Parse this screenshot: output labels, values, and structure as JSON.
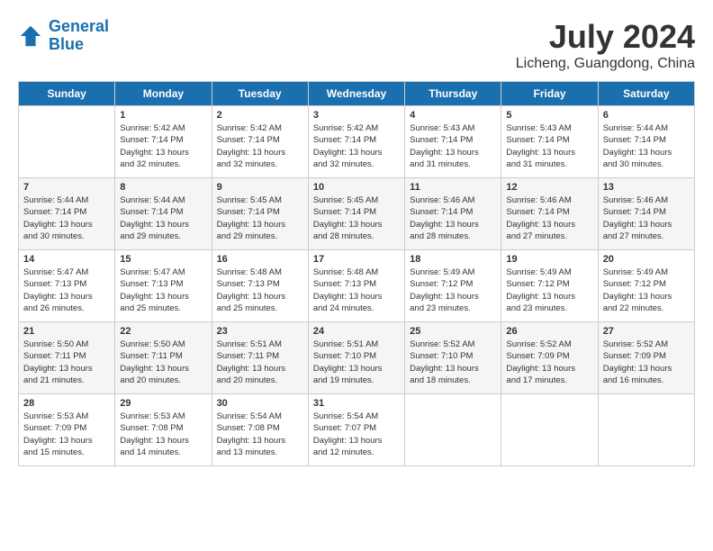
{
  "header": {
    "logo_line1": "General",
    "logo_line2": "Blue",
    "month_year": "July 2024",
    "location": "Licheng, Guangdong, China"
  },
  "weekdays": [
    "Sunday",
    "Monday",
    "Tuesday",
    "Wednesday",
    "Thursday",
    "Friday",
    "Saturday"
  ],
  "weeks": [
    [
      {
        "day": "",
        "sunrise": "",
        "sunset": "",
        "daylight": ""
      },
      {
        "day": "1",
        "sunrise": "Sunrise: 5:42 AM",
        "sunset": "Sunset: 7:14 PM",
        "daylight": "Daylight: 13 hours and 32 minutes."
      },
      {
        "day": "2",
        "sunrise": "Sunrise: 5:42 AM",
        "sunset": "Sunset: 7:14 PM",
        "daylight": "Daylight: 13 hours and 32 minutes."
      },
      {
        "day": "3",
        "sunrise": "Sunrise: 5:42 AM",
        "sunset": "Sunset: 7:14 PM",
        "daylight": "Daylight: 13 hours and 32 minutes."
      },
      {
        "day": "4",
        "sunrise": "Sunrise: 5:43 AM",
        "sunset": "Sunset: 7:14 PM",
        "daylight": "Daylight: 13 hours and 31 minutes."
      },
      {
        "day": "5",
        "sunrise": "Sunrise: 5:43 AM",
        "sunset": "Sunset: 7:14 PM",
        "daylight": "Daylight: 13 hours and 31 minutes."
      },
      {
        "day": "6",
        "sunrise": "Sunrise: 5:44 AM",
        "sunset": "Sunset: 7:14 PM",
        "daylight": "Daylight: 13 hours and 30 minutes."
      }
    ],
    [
      {
        "day": "7",
        "sunrise": "Sunrise: 5:44 AM",
        "sunset": "Sunset: 7:14 PM",
        "daylight": "Daylight: 13 hours and 30 minutes."
      },
      {
        "day": "8",
        "sunrise": "Sunrise: 5:44 AM",
        "sunset": "Sunset: 7:14 PM",
        "daylight": "Daylight: 13 hours and 29 minutes."
      },
      {
        "day": "9",
        "sunrise": "Sunrise: 5:45 AM",
        "sunset": "Sunset: 7:14 PM",
        "daylight": "Daylight: 13 hours and 29 minutes."
      },
      {
        "day": "10",
        "sunrise": "Sunrise: 5:45 AM",
        "sunset": "Sunset: 7:14 PM",
        "daylight": "Daylight: 13 hours and 28 minutes."
      },
      {
        "day": "11",
        "sunrise": "Sunrise: 5:46 AM",
        "sunset": "Sunset: 7:14 PM",
        "daylight": "Daylight: 13 hours and 28 minutes."
      },
      {
        "day": "12",
        "sunrise": "Sunrise: 5:46 AM",
        "sunset": "Sunset: 7:14 PM",
        "daylight": "Daylight: 13 hours and 27 minutes."
      },
      {
        "day": "13",
        "sunrise": "Sunrise: 5:46 AM",
        "sunset": "Sunset: 7:14 PM",
        "daylight": "Daylight: 13 hours and 27 minutes."
      }
    ],
    [
      {
        "day": "14",
        "sunrise": "Sunrise: 5:47 AM",
        "sunset": "Sunset: 7:13 PM",
        "daylight": "Daylight: 13 hours and 26 minutes."
      },
      {
        "day": "15",
        "sunrise": "Sunrise: 5:47 AM",
        "sunset": "Sunset: 7:13 PM",
        "daylight": "Daylight: 13 hours and 25 minutes."
      },
      {
        "day": "16",
        "sunrise": "Sunrise: 5:48 AM",
        "sunset": "Sunset: 7:13 PM",
        "daylight": "Daylight: 13 hours and 25 minutes."
      },
      {
        "day": "17",
        "sunrise": "Sunrise: 5:48 AM",
        "sunset": "Sunset: 7:13 PM",
        "daylight": "Daylight: 13 hours and 24 minutes."
      },
      {
        "day": "18",
        "sunrise": "Sunrise: 5:49 AM",
        "sunset": "Sunset: 7:12 PM",
        "daylight": "Daylight: 13 hours and 23 minutes."
      },
      {
        "day": "19",
        "sunrise": "Sunrise: 5:49 AM",
        "sunset": "Sunset: 7:12 PM",
        "daylight": "Daylight: 13 hours and 23 minutes."
      },
      {
        "day": "20",
        "sunrise": "Sunrise: 5:49 AM",
        "sunset": "Sunset: 7:12 PM",
        "daylight": "Daylight: 13 hours and 22 minutes."
      }
    ],
    [
      {
        "day": "21",
        "sunrise": "Sunrise: 5:50 AM",
        "sunset": "Sunset: 7:11 PM",
        "daylight": "Daylight: 13 hours and 21 minutes."
      },
      {
        "day": "22",
        "sunrise": "Sunrise: 5:50 AM",
        "sunset": "Sunset: 7:11 PM",
        "daylight": "Daylight: 13 hours and 20 minutes."
      },
      {
        "day": "23",
        "sunrise": "Sunrise: 5:51 AM",
        "sunset": "Sunset: 7:11 PM",
        "daylight": "Daylight: 13 hours and 20 minutes."
      },
      {
        "day": "24",
        "sunrise": "Sunrise: 5:51 AM",
        "sunset": "Sunset: 7:10 PM",
        "daylight": "Daylight: 13 hours and 19 minutes."
      },
      {
        "day": "25",
        "sunrise": "Sunrise: 5:52 AM",
        "sunset": "Sunset: 7:10 PM",
        "daylight": "Daylight: 13 hours and 18 minutes."
      },
      {
        "day": "26",
        "sunrise": "Sunrise: 5:52 AM",
        "sunset": "Sunset: 7:09 PM",
        "daylight": "Daylight: 13 hours and 17 minutes."
      },
      {
        "day": "27",
        "sunrise": "Sunrise: 5:52 AM",
        "sunset": "Sunset: 7:09 PM",
        "daylight": "Daylight: 13 hours and 16 minutes."
      }
    ],
    [
      {
        "day": "28",
        "sunrise": "Sunrise: 5:53 AM",
        "sunset": "Sunset: 7:09 PM",
        "daylight": "Daylight: 13 hours and 15 minutes."
      },
      {
        "day": "29",
        "sunrise": "Sunrise: 5:53 AM",
        "sunset": "Sunset: 7:08 PM",
        "daylight": "Daylight: 13 hours and 14 minutes."
      },
      {
        "day": "30",
        "sunrise": "Sunrise: 5:54 AM",
        "sunset": "Sunset: 7:08 PM",
        "daylight": "Daylight: 13 hours and 13 minutes."
      },
      {
        "day": "31",
        "sunrise": "Sunrise: 5:54 AM",
        "sunset": "Sunset: 7:07 PM",
        "daylight": "Daylight: 13 hours and 12 minutes."
      },
      {
        "day": "",
        "sunrise": "",
        "sunset": "",
        "daylight": ""
      },
      {
        "day": "",
        "sunrise": "",
        "sunset": "",
        "daylight": ""
      },
      {
        "day": "",
        "sunrise": "",
        "sunset": "",
        "daylight": ""
      }
    ]
  ]
}
